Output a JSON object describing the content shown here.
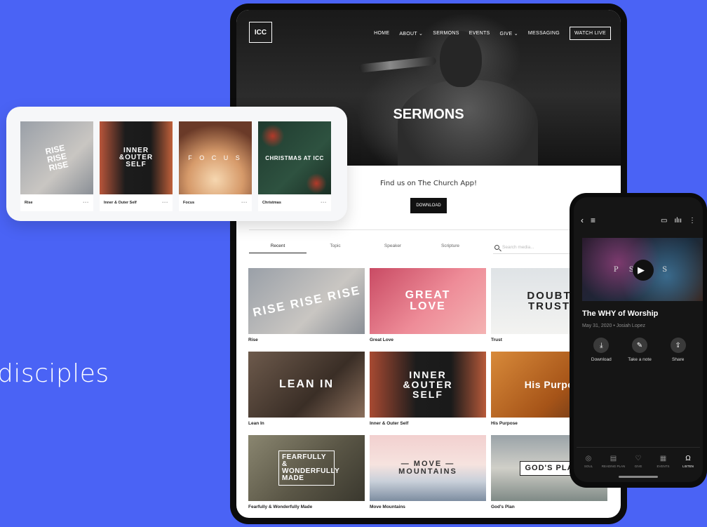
{
  "tagline": "disciples",
  "site": {
    "logo": "ICC",
    "nav": [
      "HOME",
      "ABOUT ⌄",
      "SERMONS",
      "EVENTS",
      "GIVE ⌄",
      "MESSAGING"
    ],
    "watch_live": "WATCH LIVE",
    "hero_title": "SERMONS",
    "cta_text": "Find us on The Church App!",
    "cta_button": "DOWNLOAD",
    "tabs": [
      "Recent",
      "Topic",
      "Speaker",
      "Scripture"
    ],
    "search_placeholder": "Search media...",
    "sermons": [
      {
        "label": "Rise",
        "art": "RISE RISE RISE"
      },
      {
        "label": "Great Love",
        "art": "GREAT LOVE"
      },
      {
        "label": "Trust",
        "art": "DOUBT TRUST"
      },
      {
        "label": "Lean In",
        "art": "LEAN IN"
      },
      {
        "label": "Inner & Outer Self",
        "art": "INNER &OUTER SELF"
      },
      {
        "label": "His Purpose",
        "art": "His Purpo"
      },
      {
        "label": "Fearfully & Wonderfully Made",
        "art": "FEARFULLY & WONDERFULLY MADE"
      },
      {
        "label": "Move Mountains",
        "art": "— MOVE — MOUNTAINS"
      },
      {
        "label": "God's Plan",
        "art": "GOD'S PLA"
      }
    ]
  },
  "floating": [
    {
      "label": "Rise",
      "art": "RISE RISE RISE",
      "more": "•••"
    },
    {
      "label": "Inner & Outer Self",
      "art": "INNER &OUTER SELF",
      "more": "•••"
    },
    {
      "label": "Focus",
      "art": "F O C U S",
      "more": "•••"
    },
    {
      "label": "Christmas",
      "art": "CHRISTMAS AT ICC",
      "more": "•••"
    }
  ],
  "phone": {
    "art": "P S   M S",
    "title": "The WHY of Worship",
    "subtitle": "May 31, 2020 • Josiah Lopez",
    "actions": [
      "Download",
      "Take a note",
      "Share"
    ],
    "tabs": [
      "SOUL",
      "READING PLAN",
      "GIVE",
      "EVENTS",
      "LISTEN"
    ]
  }
}
